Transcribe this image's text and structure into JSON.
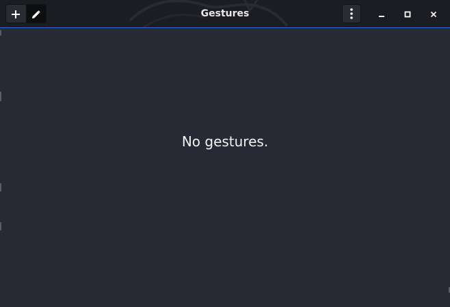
{
  "window": {
    "title": "Gestures"
  },
  "headerbar": {
    "add_button_icon": "plus-icon",
    "edit_button_icon": "pencil-icon",
    "menu_button_icon": "vertical-dots-icon",
    "minimize_icon": "minimize-icon",
    "maximize_icon": "maximize-icon",
    "close_icon": "close-icon"
  },
  "main": {
    "empty_message": "No gestures."
  },
  "colors": {
    "accent": "#2f6bd6",
    "headerbar_bg": "#1c1d22",
    "content_bg": "#272a34",
    "text": "#f2f2f2"
  }
}
